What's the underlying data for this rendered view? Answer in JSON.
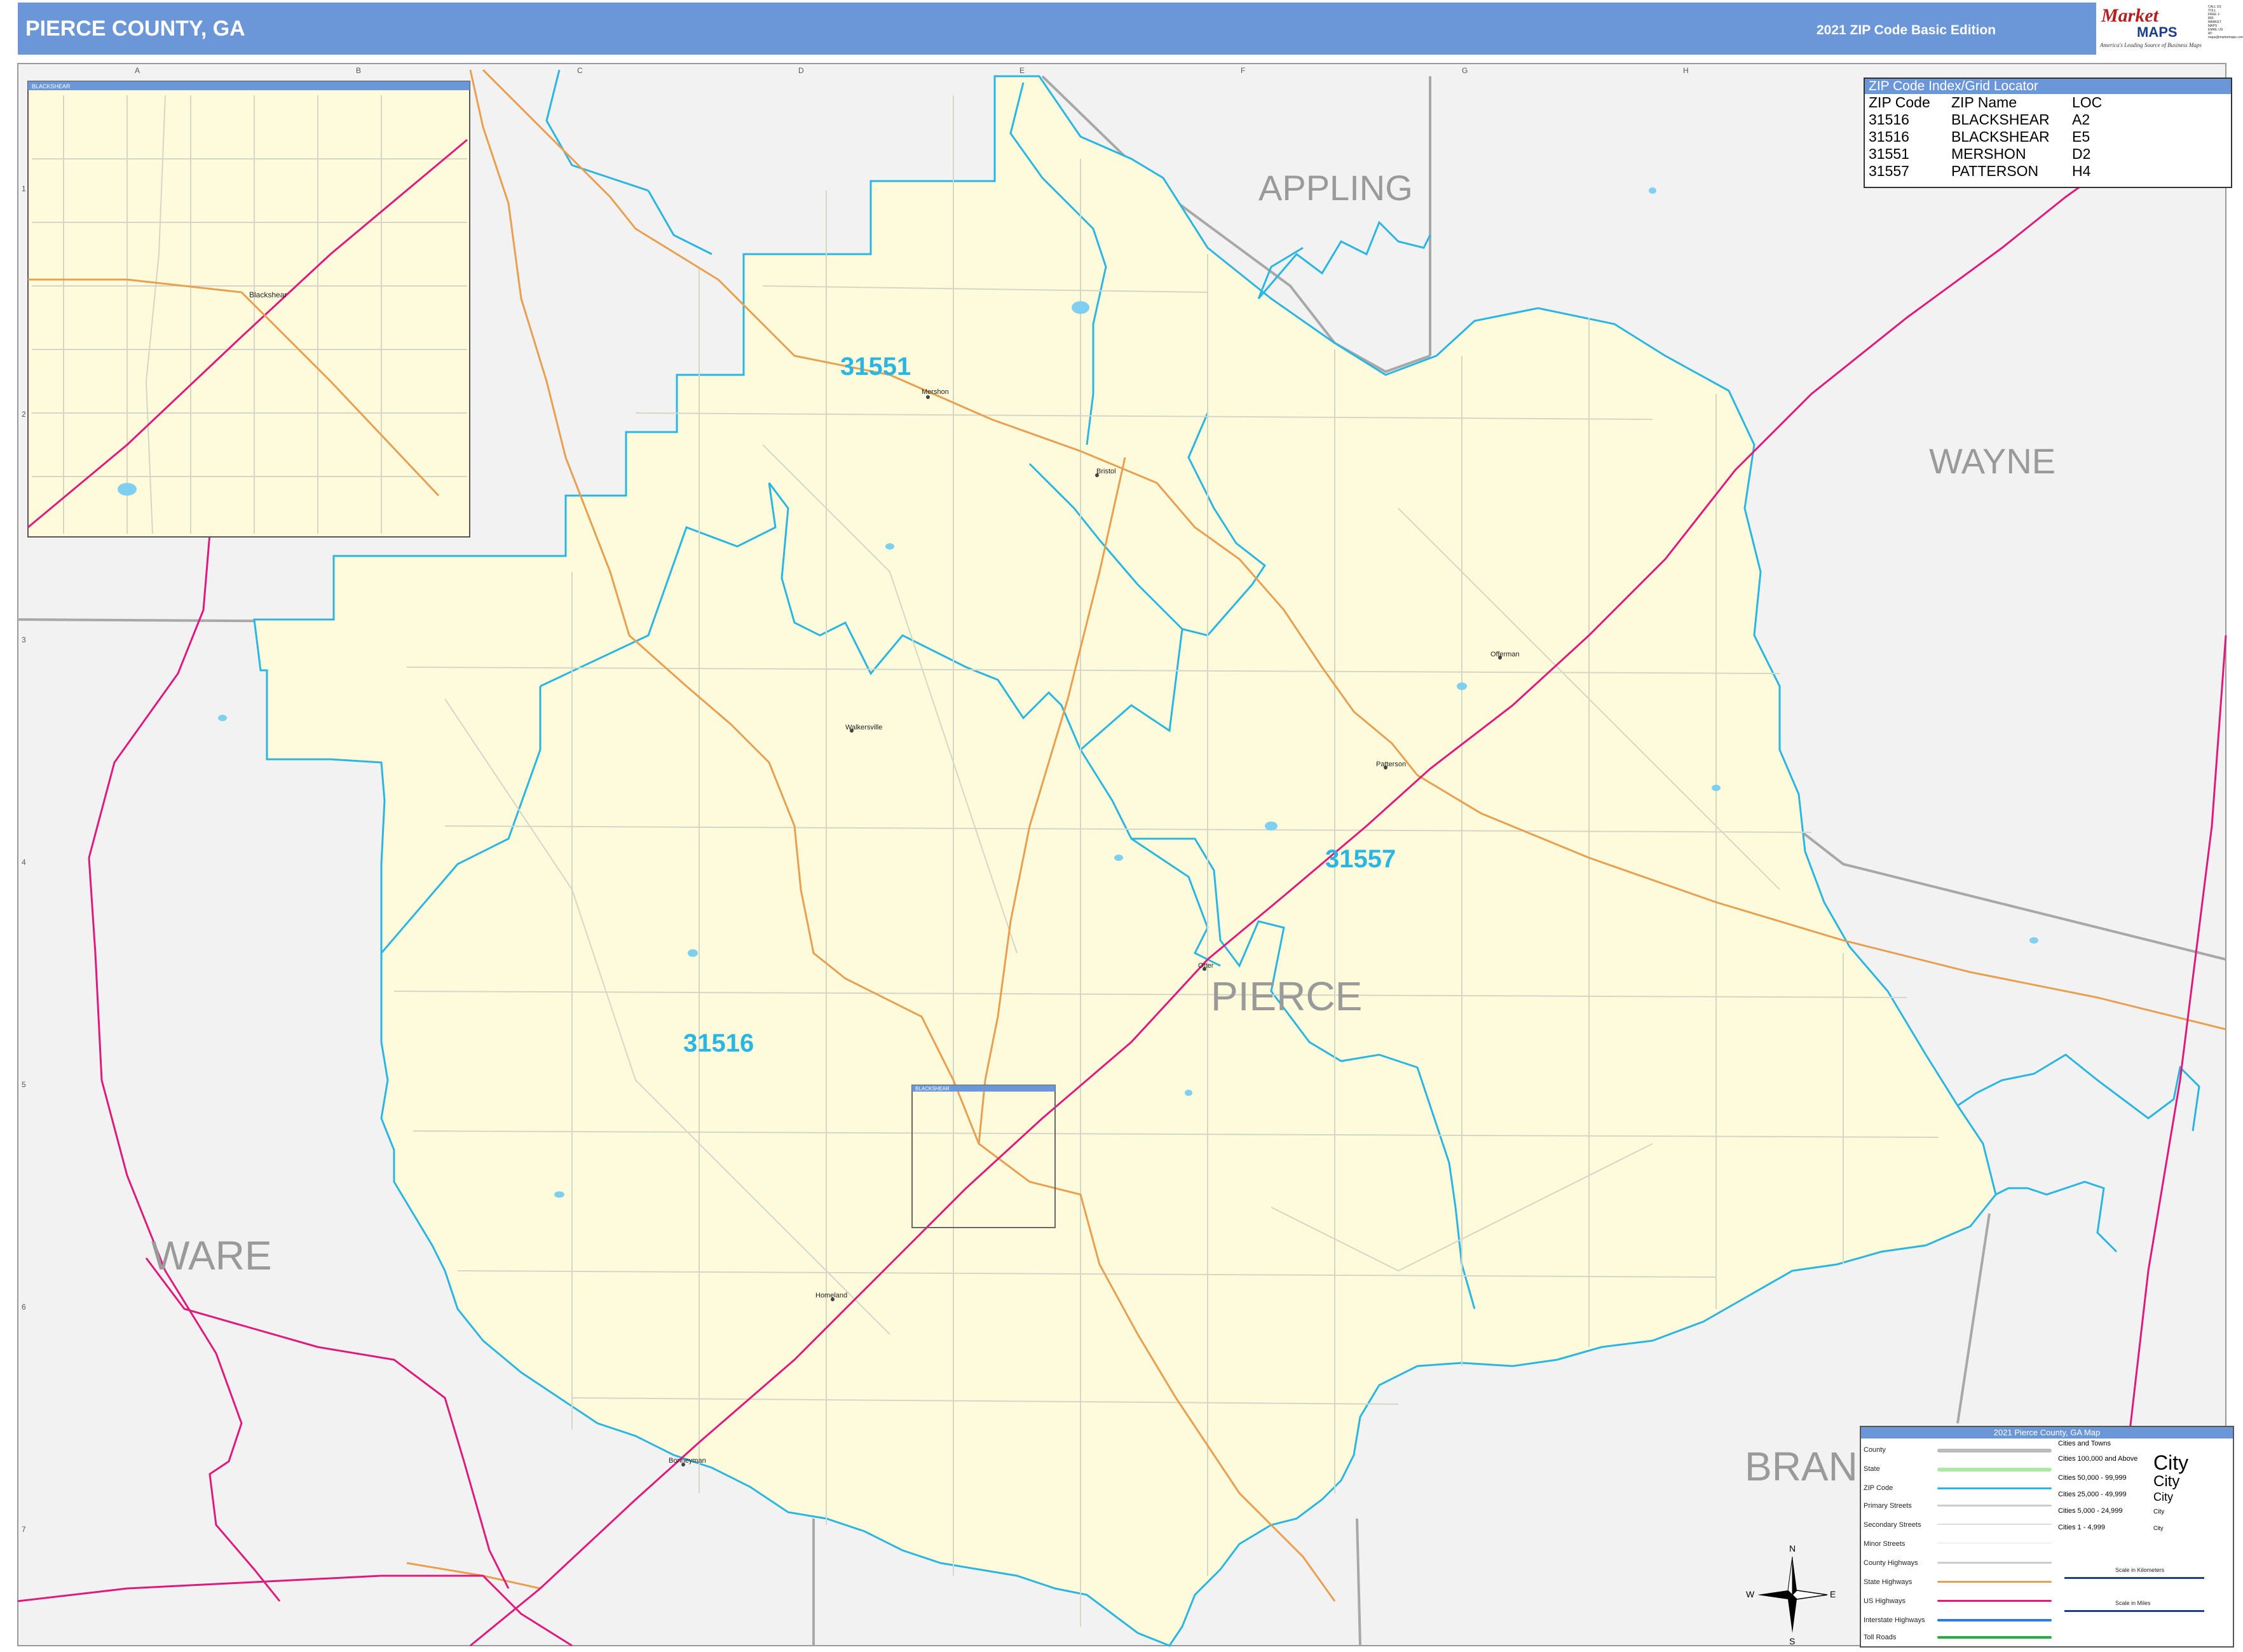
{
  "header": {
    "title": "PIERCE COUNTY, GA",
    "edition": "2021 ZIP Code Basic Edition",
    "logo": {
      "brand_top": "Market",
      "brand_bottom": "MAPS",
      "tagline": "America's Leading Source of Business Maps",
      "side_text": "CALL US TOLL FREE 1-800-MARKET MAPS EMAIL US AT: maps@marketmaps.com"
    }
  },
  "grid": {
    "columns": [
      "A",
      "B",
      "C",
      "D",
      "E",
      "F",
      "G",
      "H"
    ],
    "rows": [
      "1",
      "2",
      "3",
      "4",
      "5",
      "6",
      "7"
    ]
  },
  "inset": {
    "title": "BLACKSHEAR",
    "city": "Blackshear"
  },
  "blackshear_box_label": "BLACKSHEAR",
  "counties": {
    "appling": "APPLING",
    "wayne": "WAYNE",
    "pierce": "PIERCE",
    "ware": "WARE",
    "brantley": "BRAN"
  },
  "zips": {
    "z31551": "31551",
    "z31557": "31557",
    "z31516": "31516"
  },
  "places": {
    "mershon": "Mershon",
    "bristol": "Bristol",
    "walkersville": "Walkersville",
    "offerman": "Offerman",
    "patterson": "Patterson",
    "otter": "Otter",
    "homeland": "Homeland",
    "bonneyman": "Bonneyman"
  },
  "zip_index": {
    "title": "ZIP Code Index/Grid Locator",
    "headers": [
      "ZIP Code",
      "ZIP Name",
      "LOC"
    ],
    "rows": [
      [
        "31516",
        "BLACKSHEAR",
        "A2"
      ],
      [
        "31516",
        "BLACKSHEAR",
        "E5"
      ],
      [
        "31551",
        "MERSHON",
        "D2"
      ],
      [
        "31557",
        "PATTERSON",
        "H4"
      ]
    ]
  },
  "legend": {
    "title": "2021 Pierce County, GA Map",
    "items": [
      "County",
      "State",
      "ZIP Code",
      "Primary Streets",
      "Secondary Streets",
      "Minor Streets",
      "County Highways",
      "State Highways",
      "US Highways",
      "Interstate Highways",
      "Toll Roads"
    ],
    "cities_title": "Cities and Towns",
    "cities": [
      {
        "range": "Cities 100,000 and Above",
        "sample": "City"
      },
      {
        "range": "Cities 50,000 - 99,999",
        "sample": "City"
      },
      {
        "range": "Cities 25,000 - 49,999",
        "sample": "City"
      },
      {
        "range": "Cities 5,000 - 24,999",
        "sample": "City"
      },
      {
        "range": "Cities 1 - 4,999",
        "sample": "City"
      }
    ],
    "scale_km": "Scale in Kilometers",
    "scale_mi": "Scale in Miles"
  },
  "compass": {
    "n": "N",
    "s": "S",
    "e": "E",
    "w": "W"
  },
  "colors": {
    "header_bg": "#6b97d8",
    "county_fill": "#fdfbdc",
    "surround_fill": "#f2f2f2",
    "zip_line": "#2ab6e0",
    "county_line": "#a8a8a8",
    "us_highway": "#e0197d",
    "state_highway": "#e8a050",
    "county_highway": "#bbbbbb",
    "zip_label": "#2ab6e0",
    "county_label": "#9a9a9a"
  }
}
